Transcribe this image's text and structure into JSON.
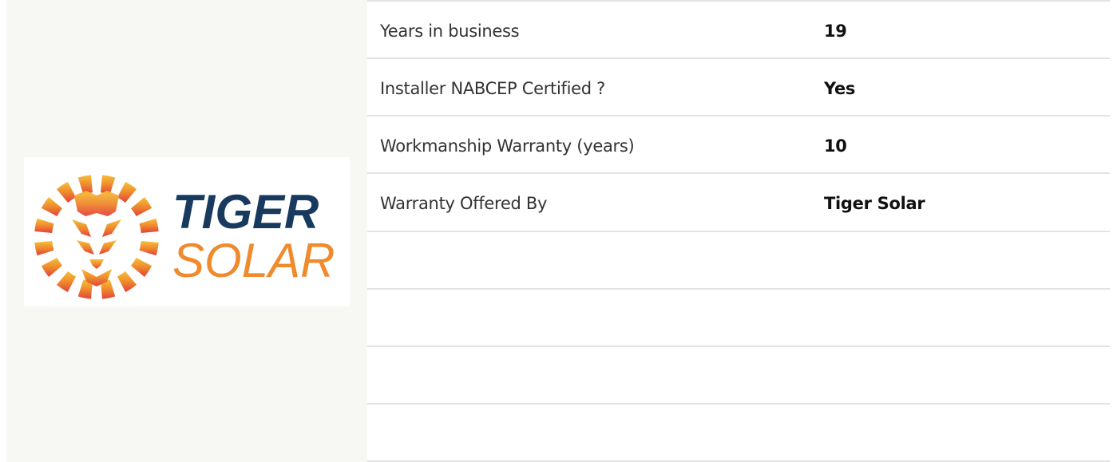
{
  "logo": {
    "line1": "TIGER",
    "line2": "SOLAR",
    "colors": {
      "navy": "#173a5e",
      "orange": "#ef8a2d",
      "yellow": "#f5b537",
      "red": "#e5473a"
    }
  },
  "details": {
    "rows": [
      {
        "label": "Years in business",
        "value": "19"
      },
      {
        "label": "Installer NABCEP Certified ?",
        "value": "Yes"
      },
      {
        "label": "Workmanship Warranty (years)",
        "value": "10"
      },
      {
        "label": "Warranty Offered By",
        "value": "Tiger Solar"
      },
      {
        "label": "",
        "value": ""
      },
      {
        "label": "",
        "value": ""
      },
      {
        "label": "",
        "value": ""
      },
      {
        "label": "",
        "value": ""
      }
    ]
  }
}
